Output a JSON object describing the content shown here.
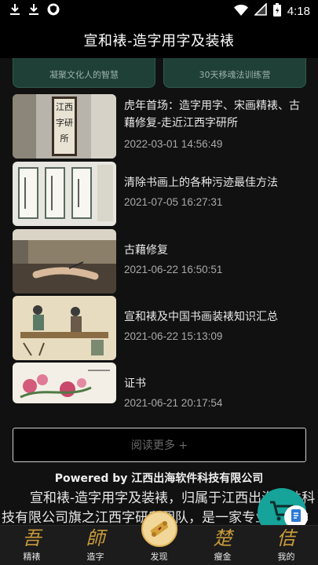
{
  "status": {
    "time": "4:18"
  },
  "header": {
    "title": "宣和裱-造字用字及装裱"
  },
  "banners": [
    {
      "caption": "凝聚文化人的智慧"
    },
    {
      "caption": "30天移魂法训练营"
    }
  ],
  "articles": [
    {
      "title": "虎年首场：造字用字、宋画精裱、古藉修复-走近江西字研所",
      "date": "2022-03-01 14:56:49",
      "thumb_text": "江西字研所"
    },
    {
      "title": "清除书画上的各种污迹最佳方法",
      "date": "2021-07-05 16:27:31"
    },
    {
      "title": "古藉修复",
      "date": "2021-06-22 16:50:51"
    },
    {
      "title": "宣和裱及中国书画装裱知识汇总",
      "date": "2021-06-22 15:13:09"
    },
    {
      "title": "证书",
      "date": "2021-06-21 20:17:54"
    }
  ],
  "more_button": {
    "label": "阅读更多 +"
  },
  "footer": {
    "powered": "Powered by 江西出海软件科技有限公司",
    "intro": "宣和裱-造字用字及装裱，归属于江西出海软件科技有限公司旗之江西字研所团队，是一家专业的字体"
  },
  "nav": [
    {
      "glyph": "吾",
      "label": "精裱"
    },
    {
      "glyph": "師",
      "label": "造字"
    },
    {
      "glyph": "",
      "label": "发现"
    },
    {
      "glyph": "楚",
      "label": "瘦金"
    },
    {
      "glyph": "佶",
      "label": "我的"
    }
  ],
  "colors": {
    "accent": "#c99a3b",
    "fab": "#16a39a",
    "banner": "#1f4037"
  }
}
